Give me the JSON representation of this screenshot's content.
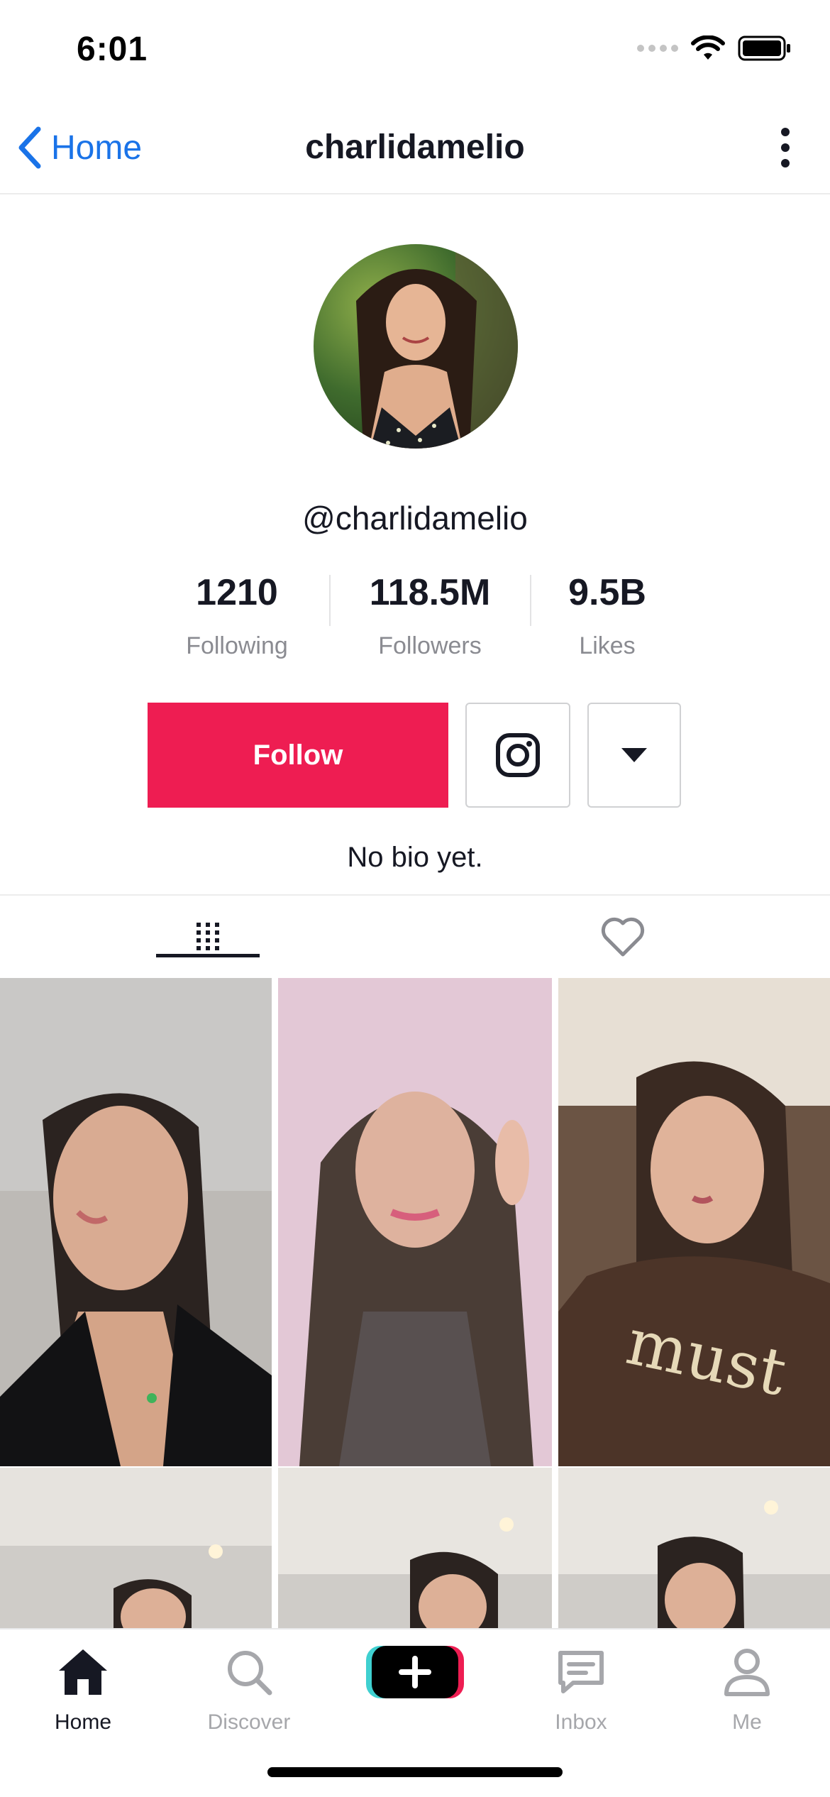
{
  "status_bar": {
    "time": "6:01"
  },
  "nav": {
    "back_label": "Home",
    "title": "charlidamelio"
  },
  "profile": {
    "username": "@charlidamelio",
    "stats": [
      {
        "value": "1210",
        "label": "Following"
      },
      {
        "value": "118.5M",
        "label": "Followers"
      },
      {
        "value": "9.5B",
        "label": "Likes"
      }
    ],
    "follow_label": "Follow",
    "bio": "No bio yet."
  },
  "icons": {
    "back": "chevron-left-icon",
    "more": "more-vertical-icon",
    "instagram": "instagram-icon",
    "dropdown": "caret-down-icon",
    "videos_tab": "grid-icon",
    "liked_tab": "heart-icon"
  },
  "colors": {
    "accent": "#ee1d52",
    "link": "#1a73e8",
    "text": "#161823",
    "muted": "#8a8b91"
  },
  "tab_bar": {
    "items": [
      {
        "label": "Home",
        "icon": "home-icon",
        "active": true
      },
      {
        "label": "Discover",
        "icon": "search-icon",
        "active": false
      },
      {
        "label": "",
        "icon": "create-plus-icon",
        "active": false
      },
      {
        "label": "Inbox",
        "icon": "inbox-icon",
        "active": false
      },
      {
        "label": "Me",
        "icon": "person-icon",
        "active": false
      }
    ]
  }
}
